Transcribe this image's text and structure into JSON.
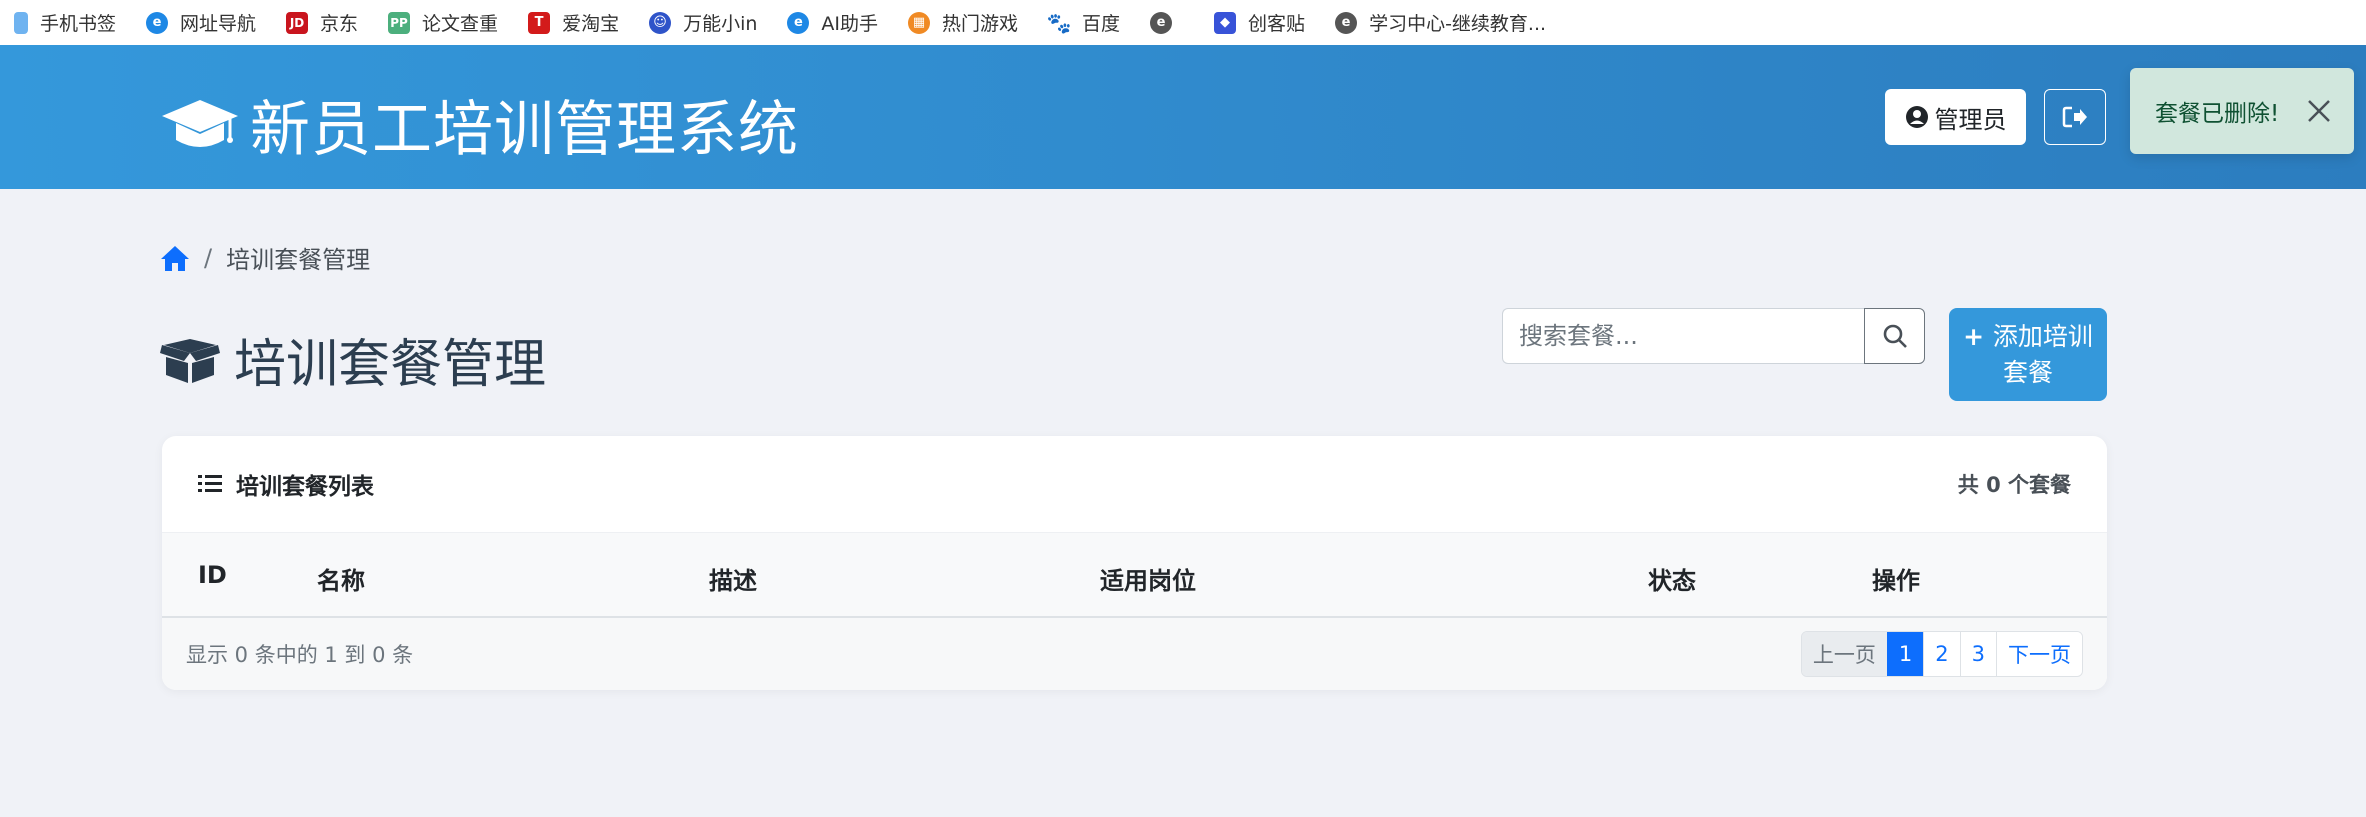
{
  "bookmarks": [
    {
      "label": "手机书签",
      "icon": "phone-icon",
      "color": "#6fb3f0"
    },
    {
      "label": "网址导航",
      "icon": "ie-icon",
      "color": "#1e88e5"
    },
    {
      "label": "京东",
      "icon": "jd-icon",
      "color": "#c9151e"
    },
    {
      "label": "论文查重",
      "icon": "pp-icon",
      "color": "#4caf7d"
    },
    {
      "label": "爱淘宝",
      "icon": "taobao-icon",
      "color": "#d31b1b"
    },
    {
      "label": "万能小in",
      "icon": "robot-icon",
      "color": "#2f54c9"
    },
    {
      "label": "AI助手",
      "icon": "ie-icon",
      "color": "#1e88e5"
    },
    {
      "label": "热门游戏",
      "icon": "game-icon",
      "color": "#f08a24"
    },
    {
      "label": "百度",
      "icon": "baidu-paw-icon",
      "color": "#2932e1"
    },
    {
      "label": "",
      "icon": "edge-icon",
      "color": "#555555"
    },
    {
      "label": "创客贴",
      "icon": "chuangkit-icon",
      "color": "#3853d8"
    },
    {
      "label": "学习中心-继续教育...",
      "icon": "edge-icon",
      "color": "#555555"
    }
  ],
  "header": {
    "title": "新员工培训管理系统",
    "user_label": "管理员"
  },
  "toast": {
    "message": "套餐已删除!"
  },
  "breadcrumb": {
    "current": "培训套餐管理",
    "separator": "/"
  },
  "page": {
    "title": "培训套餐管理",
    "search_placeholder": "搜索套餐...",
    "add_button": "添加培训套餐"
  },
  "card": {
    "title": "培训套餐列表",
    "count_text": "共 0 个套餐",
    "columns": [
      "ID",
      "名称",
      "描述",
      "适用岗位",
      "状态",
      "操作"
    ],
    "footer_info": "显示 0 条中的 1 到 0 条",
    "pagination": {
      "prev": "上一页",
      "pages": [
        "1",
        "2",
        "3"
      ],
      "current": "1",
      "next": "下一页"
    }
  },
  "colors": {
    "header_start": "#3498db",
    "header_end": "#2c7dbf",
    "primary": "#0d6efd",
    "toast_bg": "#d1e7dd"
  }
}
